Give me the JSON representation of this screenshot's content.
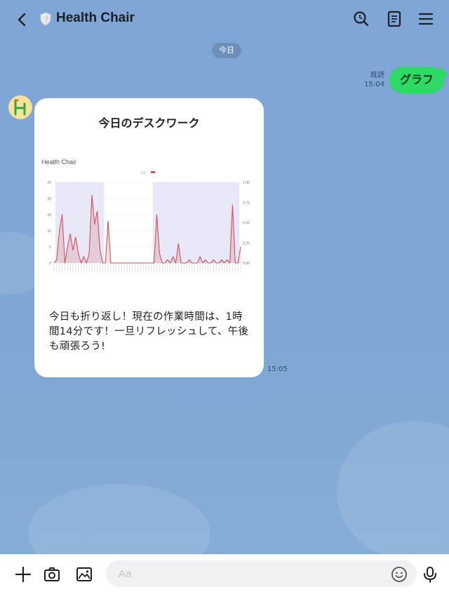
{
  "header": {
    "title": "Health Chair",
    "icons": [
      "back-icon",
      "shield-icon",
      "search-icon",
      "notes-icon",
      "menu-icon"
    ]
  },
  "date_separator": "今日",
  "outgoing": {
    "read_label": "既読",
    "time": "15:04",
    "text": "グラフ"
  },
  "incoming": {
    "title": "今日のデスクワーク",
    "message": "今日も折り返し！現在の作業時間は、1時間14分です！一旦リフレッシュして、午後も頑張ろう!",
    "time": "15:05"
  },
  "chart_data": {
    "type": "line",
    "title": "Health Chair",
    "ylim": [
      0,
      25
    ],
    "y2lim": [
      0,
      1
    ],
    "y_ticks": [
      "25",
      "20",
      "15",
      "10",
      "5",
      "0"
    ],
    "y2_ticks": [
      "1.00",
      "0.75",
      "0.50",
      "0.25",
      "0.00"
    ],
    "series": [
      {
        "color": "#d0535a",
        "values": [
          0,
          1,
          10,
          15,
          0,
          5,
          9,
          4,
          8,
          3,
          0,
          2,
          0,
          3,
          21,
          12,
          16,
          4,
          0,
          0,
          13,
          0,
          0,
          0,
          0,
          0,
          0,
          0,
          0,
          0,
          0,
          0,
          0,
          0,
          0,
          0,
          0,
          0,
          15,
          3,
          0,
          0,
          1,
          0,
          2,
          0,
          6,
          0,
          0,
          0,
          1,
          0,
          0,
          0,
          2,
          0,
          1,
          0,
          0,
          1,
          0,
          0,
          1,
          0,
          1,
          0,
          18,
          0,
          0,
          5
        ]
      },
      {
        "color": "#e6e6f7",
        "values": [
          0,
          1,
          1,
          1,
          1,
          1,
          1,
          1,
          1,
          1,
          1,
          1,
          1,
          1,
          1,
          1,
          1,
          1,
          1,
          0,
          0,
          0,
          0,
          0,
          0,
          0,
          0,
          0,
          0,
          0,
          0,
          0,
          0,
          0,
          0,
          0,
          0,
          1,
          1,
          1,
          1,
          1,
          1,
          1,
          1,
          1,
          1,
          1,
          1,
          1,
          1,
          1,
          1,
          1,
          1,
          1,
          1,
          1,
          1,
          1,
          1,
          1,
          1,
          1,
          1,
          1,
          1,
          1,
          1,
          0
        ]
      }
    ]
  },
  "input": {
    "placeholder": "Aa"
  },
  "colors": {
    "chat_bg": "#7fa7d4",
    "out_bubble": "#2fd966",
    "line": "#d0535a",
    "band": "#e6e6f7"
  }
}
